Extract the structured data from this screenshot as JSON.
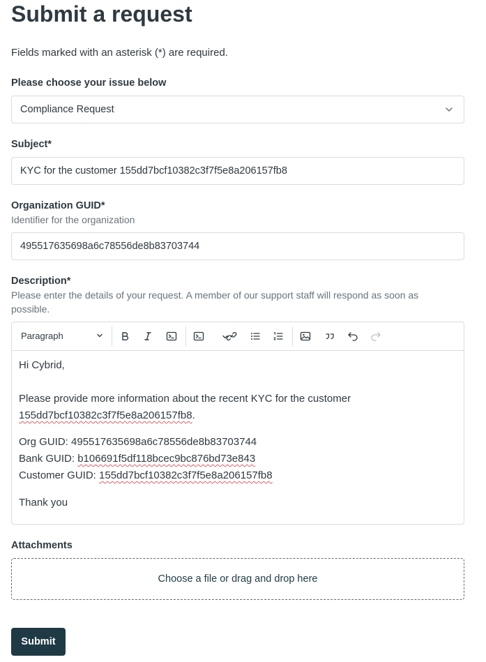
{
  "page": {
    "title": "Submit a request",
    "required_note": "Fields marked with an asterisk (*) are required."
  },
  "issue": {
    "label": "Please choose your issue below",
    "selected": "Compliance Request"
  },
  "subject": {
    "label": "Subject*",
    "value": "KYC for the customer 155dd7bcf10382c3f7f5e8a206157fb8"
  },
  "org_guid": {
    "label": "Organization GUID*",
    "hint": "Identifier for the organization",
    "value": "495517635698a6c78556de8b83703744"
  },
  "description": {
    "label": "Description*",
    "hint": "Please enter the details of your request. A member of our support staff will respond as soon as possible.",
    "toolbar": {
      "paragraph_select": "Paragraph",
      "icons": [
        "bold-icon",
        "italic-icon",
        "code-icon",
        "code-block-icon",
        "link-icon",
        "bulleted-list-icon",
        "numbered-list-icon",
        "image-icon",
        "blockquote-icon",
        "undo-icon",
        "redo-icon"
      ]
    },
    "body": {
      "greeting": "Hi Cybrid,",
      "line1": "Please provide more information about the recent KYC for the customer",
      "line2_id": "155dd7bcf10382c3f7f5e8a206157fb8",
      "line2_tail": ".",
      "org_label": "Org GUID: ",
      "org_value": "495517635698a6c78556de8b83703744",
      "bank_label": "Bank GUID: ",
      "bank_value": "b106691f5df118bcec9bc876bd73e843",
      "customer_label": "Customer GUID: ",
      "customer_value": "155dd7bcf10382c3f7f5e8a206157fb8",
      "closing": "Thank you"
    }
  },
  "attachments": {
    "label": "Attachments",
    "dropzone_text": "Choose a file or drag and drop here"
  },
  "submit": {
    "label": "Submit"
  },
  "colors": {
    "text": "#2f3941",
    "muted": "#68737d",
    "border": "#d8dcde",
    "primary": "#1f3a45",
    "spellcheck": "#e35b66"
  }
}
